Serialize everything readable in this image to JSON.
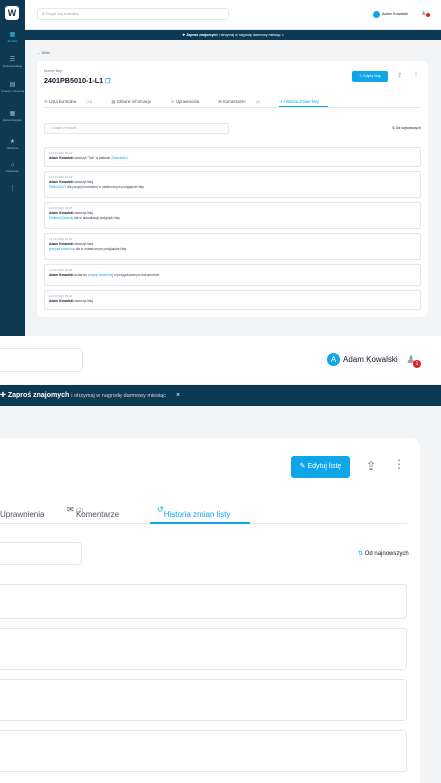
{
  "app": {
    "logo_letter": "W"
  },
  "sidebar": {
    "items": [
      {
        "icon": "file-icon",
        "glyph": "▦",
        "label": "Moduły"
      },
      {
        "icon": "list-icon",
        "glyph": "☰",
        "label": "Dokumentacja"
      },
      {
        "icon": "doc-icon",
        "glyph": "▤",
        "label": "Umowy i zlecenia"
      },
      {
        "icon": "calendar-icon",
        "glyph": "▦",
        "label": "Harmonogram"
      },
      {
        "icon": "star-icon",
        "glyph": "★",
        "label": "Ulubione"
      },
      {
        "icon": "home-icon",
        "glyph": "⌂",
        "label": "Instytucje"
      },
      {
        "icon": "more-icon",
        "glyph": "⋮",
        "label": ""
      }
    ]
  },
  "topbar": {
    "search_placeholder": "Znajdź moj kontrolny...",
    "user_name": "Adam Kowalski",
    "user_initial": "A",
    "notifications": "1"
  },
  "banner": {
    "title": "Zaproś znajomych",
    "rest": "i otrzymaj w nagrodę darmowy miesiąc",
    "close": "×"
  },
  "breadcrumb": {
    "back": "← Wróć"
  },
  "list": {
    "label": "Numer listy",
    "title": "2401PB5010-1-L1",
    "edit_label": "Edytuj listę",
    "tabs": [
      {
        "label": "Lista kontrolna",
        "count": "(14)"
      },
      {
        "label": "Główne informacje",
        "count": ""
      },
      {
        "label": "Uprawnienia",
        "count": ""
      },
      {
        "label": "Komentarze",
        "count": "(2)"
      },
      {
        "label": "Historia zmian listy",
        "count": ""
      }
    ],
    "history_search_placeholder": "Znajdź w historii",
    "sort_label": "Od najnowszych"
  },
  "history": [
    {
      "date": "12.03.2024 10:22",
      "user": "Adam Kowalski",
      "text": "utworzył \"Tak\" w statusie",
      "link": "Zdarzenie 1",
      "extra": ""
    },
    {
      "date": "12.03.2024 10:19",
      "user": "Adam Kowalski",
      "text": "utworzył listę",
      "link": "PB5010/1/1",
      "extra": "dla pozycji kontrolnej w ostatecznym podglądzie listy"
    },
    {
      "date": "12.03.2024 10:15",
      "user": "Adam Kowalski",
      "text": "utworzył listę",
      "link": "Elektryk/Zespoły",
      "extra": "dla w aktualizacji podglądu listy"
    },
    {
      "date": "12.03.2024 10:10",
      "user": "Adam Kowalski",
      "text": "utworzył listę",
      "link": "pozycja kontrolna",
      "extra": "dla w ostatecznym podglądzie listy"
    },
    {
      "date": "12.03.2024 09:58",
      "user": "Adam Kowalski",
      "text": "dodał do",
      "link": "pozycji kontrolnej",
      "extra": "w przygotowanym dokumencie"
    },
    {
      "date": "12.03.2024 09:40",
      "user": "Adam Kowalski",
      "text": "utworzył listę",
      "link": "",
      "extra": ""
    }
  ]
}
